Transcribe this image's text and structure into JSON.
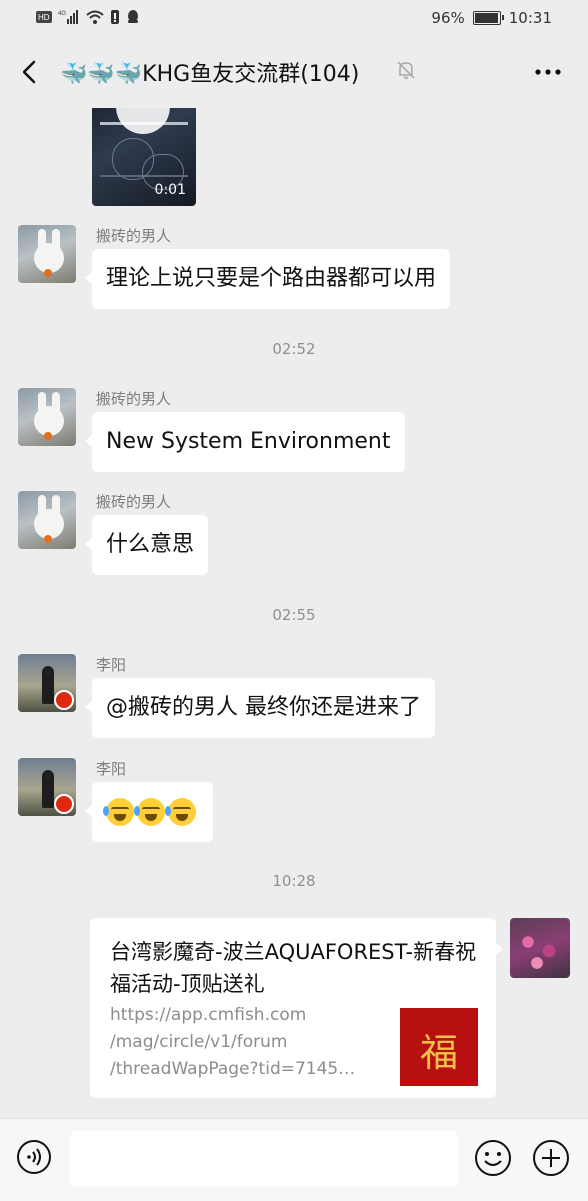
{
  "status_bar": {
    "left_badges": [
      "HD",
      "4G"
    ],
    "battery_text": "96%",
    "battery_level": 0.96,
    "time": "10:31"
  },
  "nav": {
    "title": "🐳🐳🐳KHG鱼友交流群(104)"
  },
  "video": {
    "duration": "0:01"
  },
  "messages": [
    {
      "sender": "搬砖的男人",
      "text": "理论上说只要是个路由器都可以用"
    },
    {
      "sender": "搬砖的男人",
      "text": "New System Environment"
    },
    {
      "sender": "搬砖的男人",
      "text": "什么意思"
    },
    {
      "sender": "李阳",
      "text": "@搬砖的男人  最终你还是进来了"
    },
    {
      "sender": "李阳",
      "text": ""
    }
  ],
  "timestamps": [
    "02:52",
    "02:55",
    "10:28"
  ],
  "link_card": {
    "title": "台湾影魔奇-波兰AQUAFOREST-新春祝福活动-顶贴送礼",
    "url_lines": [
      "https://app.cmfish.com",
      "/mag/circle/v1/forum",
      "/threadWapPage?tid=7145…"
    ],
    "thumb_char": "福"
  },
  "colors": {
    "bg": "#ededed",
    "bubble": "#ffffff",
    "meta_text": "#8f8f8f"
  },
  "icons": [
    "back-arrow-icon",
    "mute-bell-icon",
    "more-icon",
    "voice-icon",
    "emoji-icon",
    "plus-icon",
    "play-icon"
  ]
}
